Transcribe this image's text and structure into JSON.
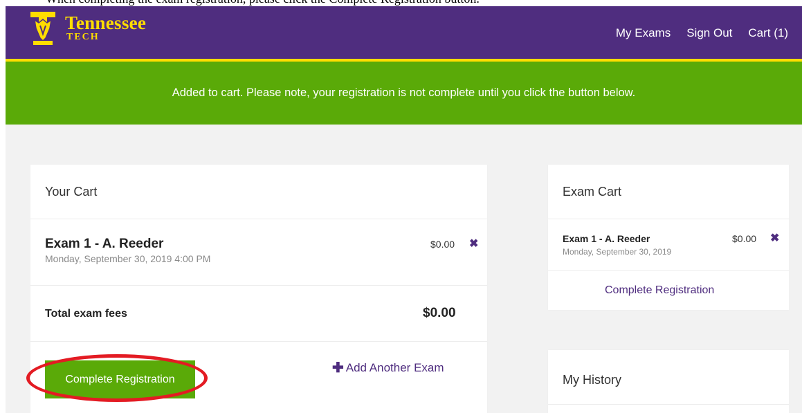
{
  "document": {
    "caption_fragment": "When completing the exam registration, please click the Complete Registration button."
  },
  "brand": {
    "name": "Tennessee",
    "sub": "TECH",
    "colors": {
      "purple": "#4f2d7f",
      "gold": "#ffdd00",
      "green": "#5aaa08",
      "red": "#e31b23"
    }
  },
  "nav": {
    "links": [
      "My Exams",
      "Sign Out",
      "Cart (1)"
    ]
  },
  "notice": {
    "text": "Added to cart. Please note, your registration is not complete until you click the button below."
  },
  "cart": {
    "title": "Your Cart",
    "item": {
      "name": "Exam 1 - A. Reeder",
      "datetime": "Monday, September 30, 2019 4:00 PM",
      "price": "$0.00",
      "remove_icon": "close-icon"
    },
    "total_label": "Total exam fees",
    "total_value": "$0.00",
    "complete_button": "Complete Registration",
    "add_another": "Add Another Exam"
  },
  "exam_cart": {
    "title": "Exam Cart",
    "item": {
      "name": "Exam 1 - A. Reeder",
      "date": "Monday, September 30, 2019",
      "price": "$0.00"
    },
    "complete_link": "Complete Registration"
  },
  "history": {
    "title": "My History"
  }
}
